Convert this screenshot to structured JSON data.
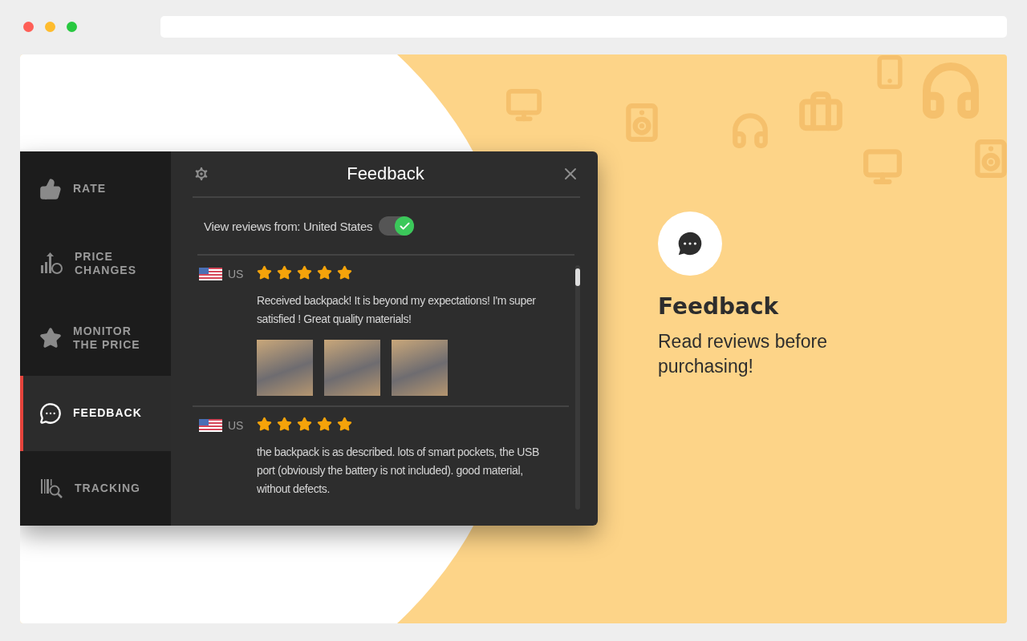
{
  "sidebar": {
    "items": [
      {
        "label": "RATE",
        "selected": false
      },
      {
        "label": "PRICE CHANGES",
        "selected": false
      },
      {
        "label": "MONITOR THE PRICE",
        "selected": false
      },
      {
        "label": "FEEDBACK",
        "selected": true
      },
      {
        "label": "TRACKING",
        "selected": false
      }
    ]
  },
  "panel": {
    "title": "Feedback",
    "filter": {
      "label": "View reviews from: United States",
      "on": true
    },
    "reviews": [
      {
        "country": "US",
        "stars": 5,
        "text": "Received backpack! It is beyond my expectations! I'm super satisfied ! Great quality materials!",
        "photos": [
          {
            "kind": "photo"
          },
          {
            "kind": "photo"
          },
          {
            "kind": "photo"
          }
        ]
      },
      {
        "country": "US",
        "stars": 5,
        "text": "the backpack is as described. lots of smart pockets, the USB port (obviously the battery is not included). good material, without defects."
      }
    ]
  },
  "feature": {
    "title": "Feedback",
    "description": "Read reviews before purchasing!"
  }
}
